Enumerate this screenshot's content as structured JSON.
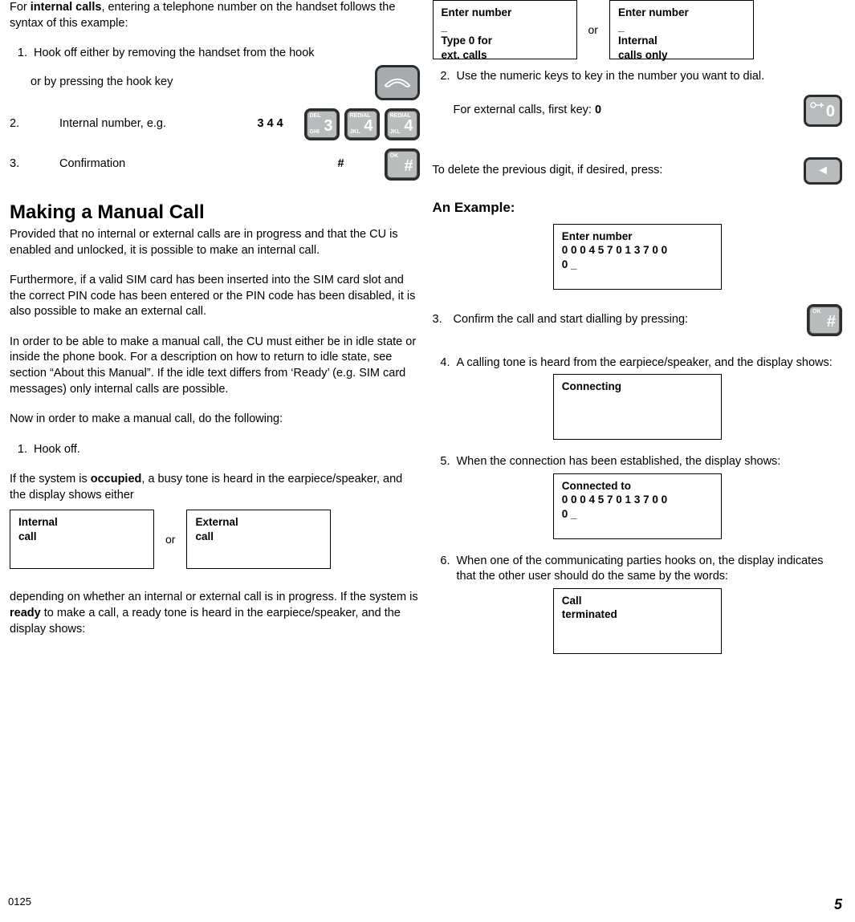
{
  "left": {
    "intro1a": "For ",
    "intro1b": "internal calls",
    "intro1c": ", entering a telephone number on the handset follows the syntax of this example:",
    "s1": "Hook off either by removing the handset from the hook",
    "s1b": "or by pressing the hook key",
    "s2a": "Internal number, e.g.",
    "s2b": "3 4 4",
    "s3a": "Confirmation",
    "s3b": "#",
    "h2": "Making a Manual Call",
    "p1": "Provided that no internal or external calls are in progress and that the CU is enabled and unlocked, it is possible to make an internal call.",
    "p2": "Furthermore, if a valid SIM card has been inserted into the SIM card slot and the correct PIN code has been entered or the PIN code has been disabled, it is also possible to make an external call.",
    "p3": "In order to be able to make a manual call, the CU must either be in idle state or inside the phone book. For a description on how to return to idle state, see section “About this Manual”. If the idle text differs from ‘Ready’ (e.g. SIM card messages) only internal calls are possible.",
    "p4": "Now in order to make a manual call, do the following:",
    "s4": "Hook off.",
    "p5a": "If the system is ",
    "p5b": "occupied",
    "p5c": ", a busy tone is heard in the earpiece/speaker, and the display shows either",
    "disp1": "Internal\ncall",
    "or": "or",
    "disp2": "External\ncall",
    "p6a": "depending on whether an internal or external call is in progress. If the system is ",
    "p6b": "ready",
    "p6c": " to make a call, a ready tone is heard in the earpiece/speaker, and the display shows:"
  },
  "right": {
    "dispA": "Enter number\n_\nType  0  for\next. calls",
    "or": "or",
    "dispB": "Enter number\n_\nInternal\ncalls only",
    "s2": "Use the numeric keys to key in the number you want to dial.",
    "s2b_a": "For external calls, first key: ",
    "s2b_b": "0",
    "del": "To delete the previous digit, if desired, press:",
    "h3": "An Example:",
    "dispC": "Enter number\n0  0  0  4  5  7  0  1  3  7  0  0\n0 _",
    "s3": "Confirm the call and start dialling by pressing:",
    "s4": "A calling tone is heard from the earpiece/speaker, and the display shows:",
    "dispD": "Connecting",
    "s5": "When the connection has been established, the display shows:",
    "dispE": "Connected to\n0  0  0  4  5  7  0  1  3  7  0  0\n0 _",
    "s6": "When one of the communicating parties hooks on, the display indicates that  the other user should do the same by the words:",
    "dispF": "Call\nterminated"
  },
  "keys": {
    "k3": {
      "tl": "DEL",
      "bl": "GHI",
      "big": "3"
    },
    "k4": {
      "tl": "REDIAL",
      "bl": "JKL",
      "big": "4"
    },
    "hash": {
      "tl": "OK",
      "big": "#"
    },
    "zero": {
      "big": "0"
    }
  },
  "footer": {
    "left": "0125",
    "page": "5"
  }
}
